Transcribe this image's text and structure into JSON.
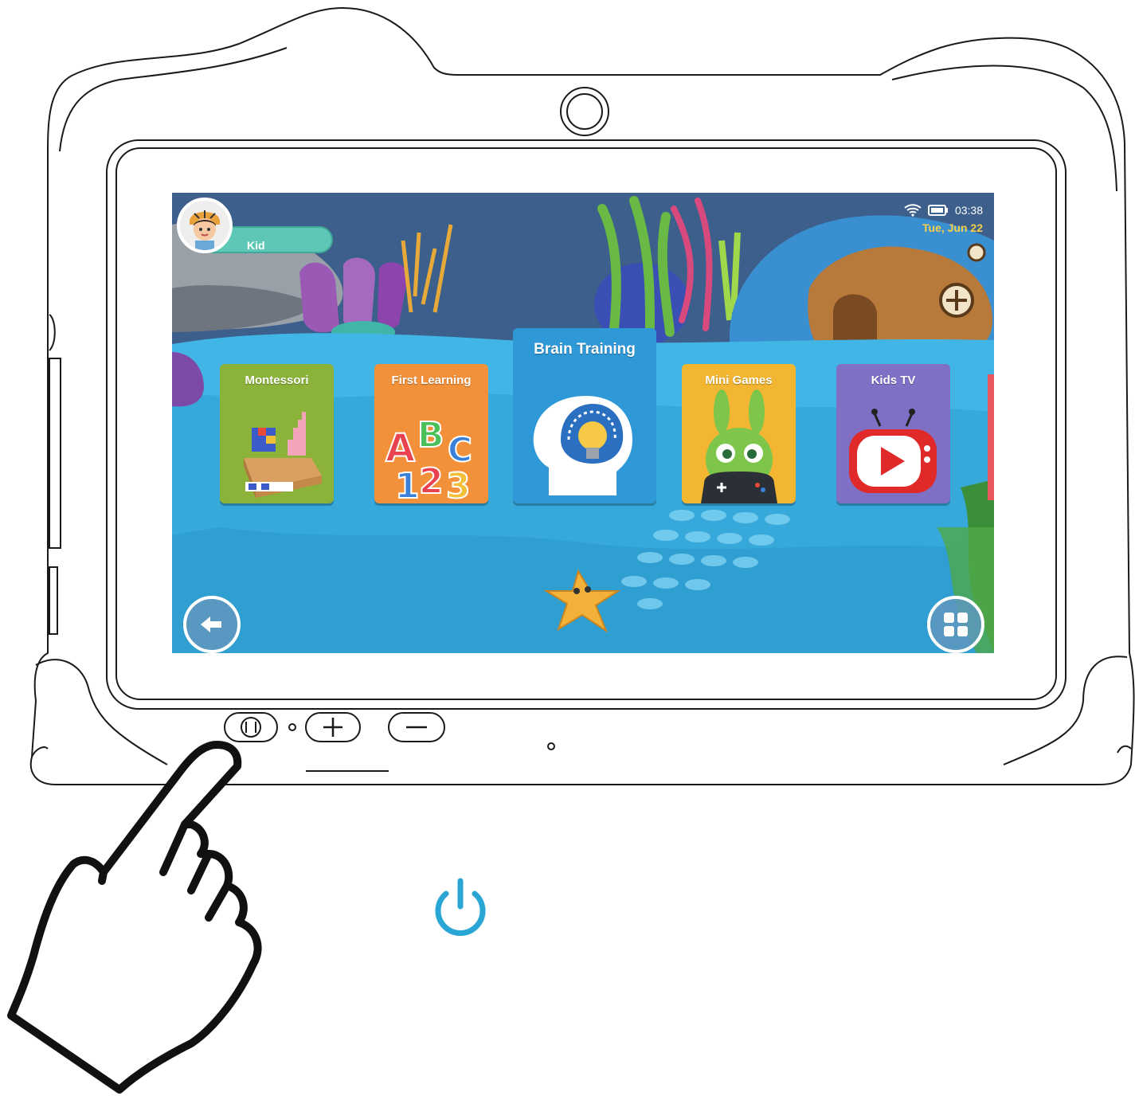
{
  "profile": {
    "name": "Kid"
  },
  "status_bar": {
    "time": "03:38",
    "date": "Tue, Jun 22"
  },
  "categories": [
    {
      "label": "Montessori",
      "icon": "blocks-icon",
      "color": "#8bb33a"
    },
    {
      "label": "First Learning",
      "icon": "abc-123-icon",
      "color": "#f2913a"
    },
    {
      "label": "Brain Training",
      "icon": "brain-lightbulb-icon",
      "color": "#2f98d6"
    },
    {
      "label": "Mini Games",
      "icon": "bunny-gamepad-icon",
      "color": "#f2b632"
    },
    {
      "label": "Kids TV",
      "icon": "tv-play-icon",
      "color": "#7f70c6"
    }
  ],
  "nav": {
    "back_icon": "back-arrow-icon",
    "apps_icon": "grid-icon"
  },
  "hardware": {
    "power_icon": "power-icon",
    "volume_up_icon": "plus-icon",
    "volume_down_icon": "minus-icon"
  },
  "accent_colors": {
    "power_symbol": "#2aa6d5",
    "ocean": "#3d5f8c",
    "water": "#41b6e6"
  }
}
